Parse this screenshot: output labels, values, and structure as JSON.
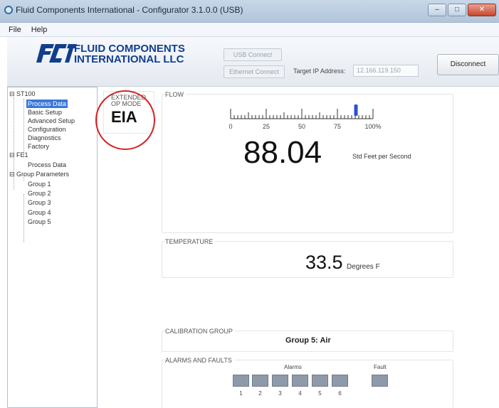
{
  "window": {
    "title": "Fluid Components International - Configurator 3.1.0.0 (USB)",
    "min": "–",
    "max": "□",
    "close": "✕"
  },
  "menu": [
    "File",
    "Help"
  ],
  "header": {
    "logo_mark": "FCI",
    "logo_line1": "FLUID COMPONENTS",
    "logo_line2": "INTERNATIONAL LLC",
    "usb_connect": "USB Connect",
    "ethernet_connect": "Ethernet Connect",
    "ip_label": "Target IP Address:",
    "ip_value": "12.166.119.150",
    "disconnect": "Disconnect"
  },
  "tree": {
    "items": [
      "ST100",
      "Process Data",
      "Basic Setup",
      "Advanced Setup",
      "Configuration",
      "Diagnostics",
      "Factory",
      "FE1",
      "Process Data",
      "Group Parameters",
      "Group 1",
      "Group 2",
      "Group 3",
      "Group 4",
      "Group 5"
    ],
    "expand_symbol": "⊟"
  },
  "mode": {
    "label": "EXTENDED OP MODE",
    "value": "EIA"
  },
  "flow": {
    "title": "FLOW",
    "value": "88.04",
    "unit": "Std Feet per Second",
    "scale_labels": [
      "0",
      "25",
      "50",
      "75",
      "100%"
    ],
    "indicator_percent": 88
  },
  "temperature": {
    "title": "TEMPERATURE",
    "value": "33.5",
    "unit": "Degrees F"
  },
  "calibration": {
    "title": "CALIBRATION GROUP",
    "value": "Group 5: Air"
  },
  "alarms": {
    "title": "ALARMS AND FAULTS",
    "alarms_label": "Alarms",
    "fault_label": "Fault",
    "numbers": [
      "1",
      "2",
      "3",
      "4",
      "5",
      "6"
    ]
  },
  "colors": {
    "selection": "#3b78d8",
    "indicator": "#2a4fd8",
    "alarm_off": "#8d9aa9",
    "annotation": "#d42222"
  }
}
